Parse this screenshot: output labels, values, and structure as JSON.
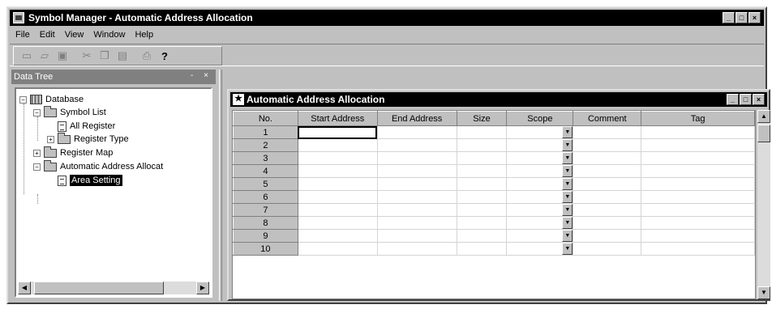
{
  "window": {
    "title": "Symbol Manager - Automatic Address Allocation",
    "controls": [
      "_",
      "□",
      "×"
    ]
  },
  "menu": [
    "File",
    "Edit",
    "View",
    "Window",
    "Help"
  ],
  "toolbar": {
    "icons": [
      "new-icon",
      "open-icon",
      "save-icon",
      "cut-icon",
      "copy-icon",
      "paste-icon",
      "print-icon",
      "help-icon"
    ],
    "help_glyph": "?"
  },
  "tree_pane": {
    "title": "Data Tree",
    "controls": "- ×",
    "nodes": [
      {
        "label": "Database",
        "expander": "−"
      },
      {
        "label": "Symbol List",
        "expander": "−"
      },
      {
        "label": "All Register",
        "expander": ""
      },
      {
        "label": "Register Type",
        "expander": "+"
      },
      {
        "label": "Register Map",
        "expander": "+"
      },
      {
        "label": "Automatic Address Allocat",
        "expander": "−"
      },
      {
        "label": "Area Setting",
        "expander": ""
      }
    ],
    "selected": "Area Setting"
  },
  "child_window": {
    "title": "Automatic Address Allocation",
    "controls": [
      "_",
      "□",
      "×"
    ]
  },
  "grid": {
    "columns": [
      "No.",
      "Start Address",
      "End Address",
      "Size",
      "Scope",
      "Comment",
      "Tag"
    ],
    "rows": [
      "1",
      "2",
      "3",
      "4",
      "5",
      "6",
      "7",
      "8",
      "9",
      "10"
    ],
    "dropdown_glyph": "▼"
  },
  "scroll": {
    "left_arrow": "◀",
    "right_arrow": "▶",
    "up_arrow": "▲",
    "down_arrow": "▼"
  }
}
